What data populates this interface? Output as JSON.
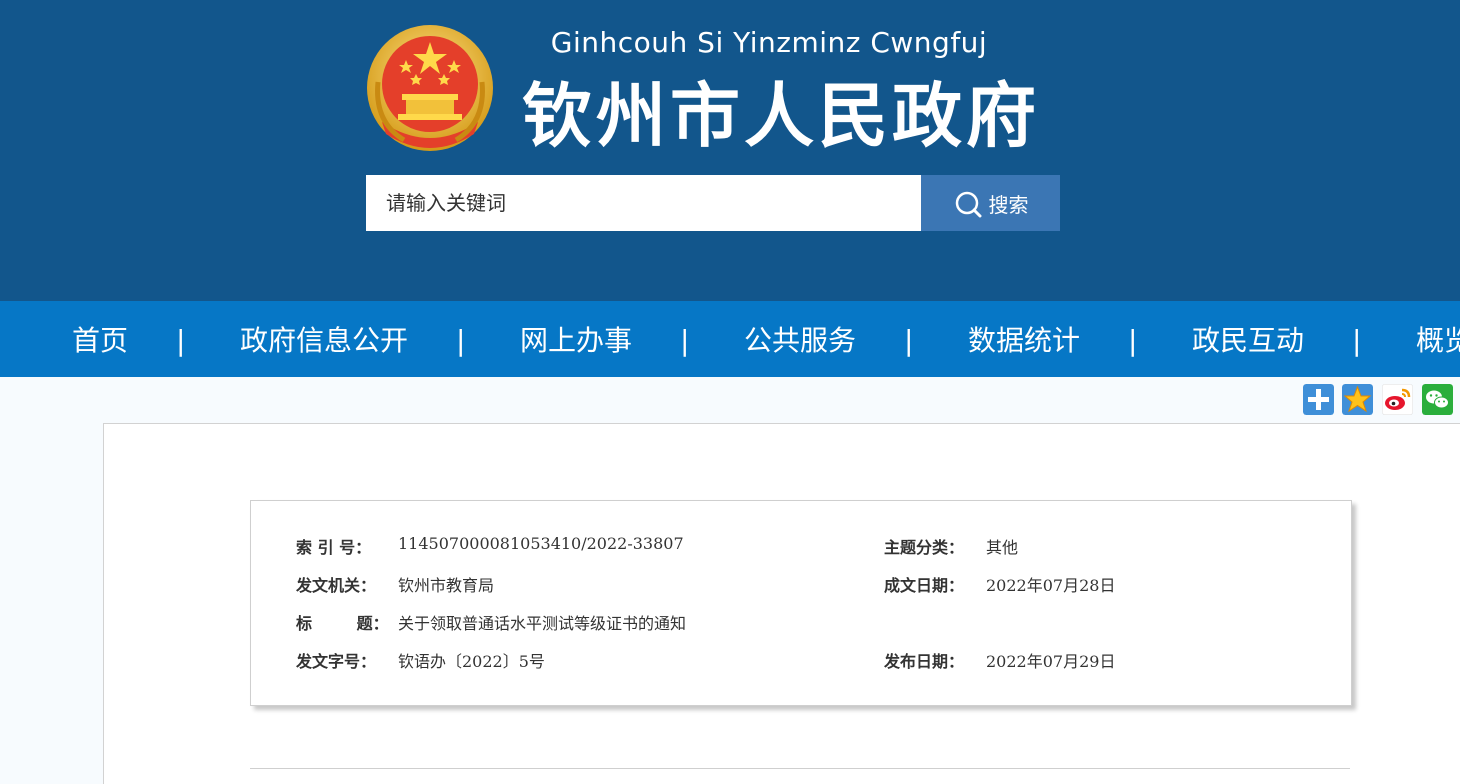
{
  "header": {
    "site_title_en": "Ginhcouh Si Yinzminz Cwngfuj",
    "site_title": "钦州市人民政府",
    "emblem_icon": "national-emblem-icon",
    "colors": {
      "header_bg": "#12568c",
      "nav_bg": "#0677c6",
      "search_btn_bg": "#3b76b4"
    }
  },
  "search": {
    "placeholder": "请输入关键词",
    "button_label": "搜索",
    "button_icon": "search-icon"
  },
  "nav": {
    "items": [
      {
        "label": "首页"
      },
      {
        "label": "政府信息公开"
      },
      {
        "label": "网上办事"
      },
      {
        "label": "公共服务"
      },
      {
        "label": "数据统计"
      },
      {
        "label": "政民互动"
      },
      {
        "label": "概览"
      }
    ],
    "separator": "|"
  },
  "share": {
    "icons": [
      "plus-share-icon",
      "favorite-star-icon",
      "weibo-icon",
      "wechat-icon"
    ]
  },
  "meta": {
    "index_no": {
      "label": "索  引  号：",
      "value": "114507000081053410/2022-33807"
    },
    "topic": {
      "label": "主题分类：",
      "value": "其他"
    },
    "issuer": {
      "label": "发文机关：",
      "value": "钦州市教育局"
    },
    "written_date": {
      "label": "成文日期：",
      "value": "2022年07月28日"
    },
    "title": {
      "label": "标        题：",
      "value": "关于领取普通话水平测试等级证书的通知"
    },
    "doc_no": {
      "label": "发文字号：",
      "value": "钦语办〔2022〕5号"
    },
    "publish_date": {
      "label": "发布日期：",
      "value": "2022年07月29日"
    }
  }
}
